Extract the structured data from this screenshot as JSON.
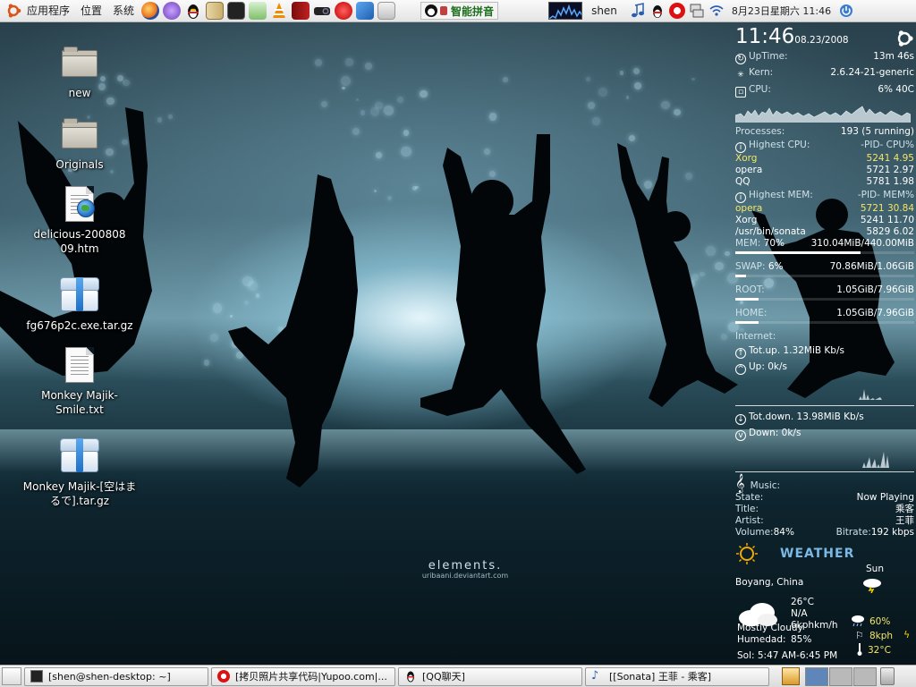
{
  "top_panel": {
    "menus": [
      "应用程序",
      "位置",
      "系统"
    ],
    "launchers": [
      "firefox-icon",
      "pidgin-icon",
      "qq-penguin-icon",
      "archive-icon",
      "terminal-icon",
      "music-player-icon",
      "vlc-icon",
      "dictionary-icon",
      "camera-icon",
      "opera-icon",
      "mail-icon",
      "network-tools-icon"
    ],
    "ime_label": "智能拼音",
    "username": "shen",
    "clock": "8月23日星期六 11:46"
  },
  "desktop_icons": [
    {
      "label": "new",
      "type": "folder"
    },
    {
      "label": "Originals",
      "type": "folder"
    },
    {
      "label": "delicious-20080809.htm",
      "type": "html"
    },
    {
      "label": "fg676p2c.exe.tar.gz",
      "type": "archive"
    },
    {
      "label": "Monkey Majik-Smile.txt",
      "type": "text"
    },
    {
      "label": "Monkey Majik-[空はまるで].tar.gz",
      "type": "archive"
    }
  ],
  "wallpaper": {
    "title": "elements.",
    "credit": "uribaani.deviantart.com"
  },
  "conky": {
    "time": "11:46",
    "date": "08.23/2008",
    "uptime_label": "UpTime:",
    "uptime": "13m 46s",
    "kern_label": "Kern:",
    "kern": "2.6.24-21-generic",
    "cpu_label": "CPU:",
    "cpu": "6% 40C",
    "processes_label": "Processes:",
    "processes": "193  (5 running)",
    "highest_cpu_label": "Highest CPU:",
    "highest_cpu_cols": "-PID-  CPU%",
    "highest_cpu": [
      {
        "name": "Xorg",
        "pid": "5241",
        "val": "4.95",
        "hl": true
      },
      {
        "name": "opera",
        "pid": "5721",
        "val": "2.97",
        "hl": false
      },
      {
        "name": "QQ",
        "pid": "5781",
        "val": "1.98",
        "hl": false
      }
    ],
    "highest_mem_label": "Highest MEM:",
    "highest_mem_cols": "-PID-  MEM%",
    "highest_mem": [
      {
        "name": "opera",
        "pid": "5721",
        "val": "30.84",
        "hl": true
      },
      {
        "name": "Xorg",
        "pid": "5241",
        "val": "11.70",
        "hl": false
      },
      {
        "name": "/usr/bin/sonata",
        "pid": "5829",
        "val": "6.02",
        "hl": false
      }
    ],
    "mem_label": "MEM:",
    "mem_pct": "70%",
    "mem": "310.04MiB/440.00MiB",
    "mem_fill": 0.7,
    "swap_label": "SWAP:",
    "swap_pct": "6%",
    "swap": "70.86MiB/1.06GiB",
    "swap_fill": 0.06,
    "root_label": "ROOT:",
    "root": "1.05GiB/7.96GiB",
    "root_fill": 0.13,
    "home_label": "HOME:",
    "home": "1.05GiB/7.96GiB",
    "home_fill": 0.13,
    "internet_label": "Internet:",
    "totup_label": "Tot.up.",
    "totup": "1.32MiB Kb/s",
    "up_label": "Up:",
    "up": "0k/s",
    "totdown_label": "Tot.down.",
    "totdown": "13.98MiB Kb/s",
    "down_label": "Down:",
    "down": "0k/s",
    "music_label": "Music:",
    "state_label": "State:",
    "state": "Now Playing",
    "title_label": "Title:",
    "title": "乘客",
    "artist_label": "Artist:",
    "artist": "王菲",
    "volume_label": "Volume:",
    "volume": "84%",
    "bitrate_label": "Bitrate:",
    "bitrate": "192 kbps",
    "weather_title": "WEATHER",
    "forecast_day": "Sun",
    "location": "Boyang, China",
    "temp": "26°C",
    "na": "N/A",
    "wind": "6kphkm/h",
    "condition": "Mostly Cloudy",
    "humidity_label": "Humedad:",
    "humidity": "85%",
    "sun": "Sol: 5:47 AM-6:45 PM",
    "fc_rain": "60%",
    "fc_wind": "8kph",
    "fc_temp": "32°C"
  },
  "taskbar": {
    "tasks": [
      {
        "label": "[shen@shen-desktop: ~]",
        "icon": "terminal-icon"
      },
      {
        "label": "[拷贝照片共享代码|Yupoo.com|...",
        "icon": "opera-icon"
      },
      {
        "label": "[QQ聊天]",
        "icon": "qq-penguin-icon"
      },
      {
        "label": "[[Sonata] 王菲 - 乘客]",
        "icon": "music-note-icon"
      }
    ]
  }
}
